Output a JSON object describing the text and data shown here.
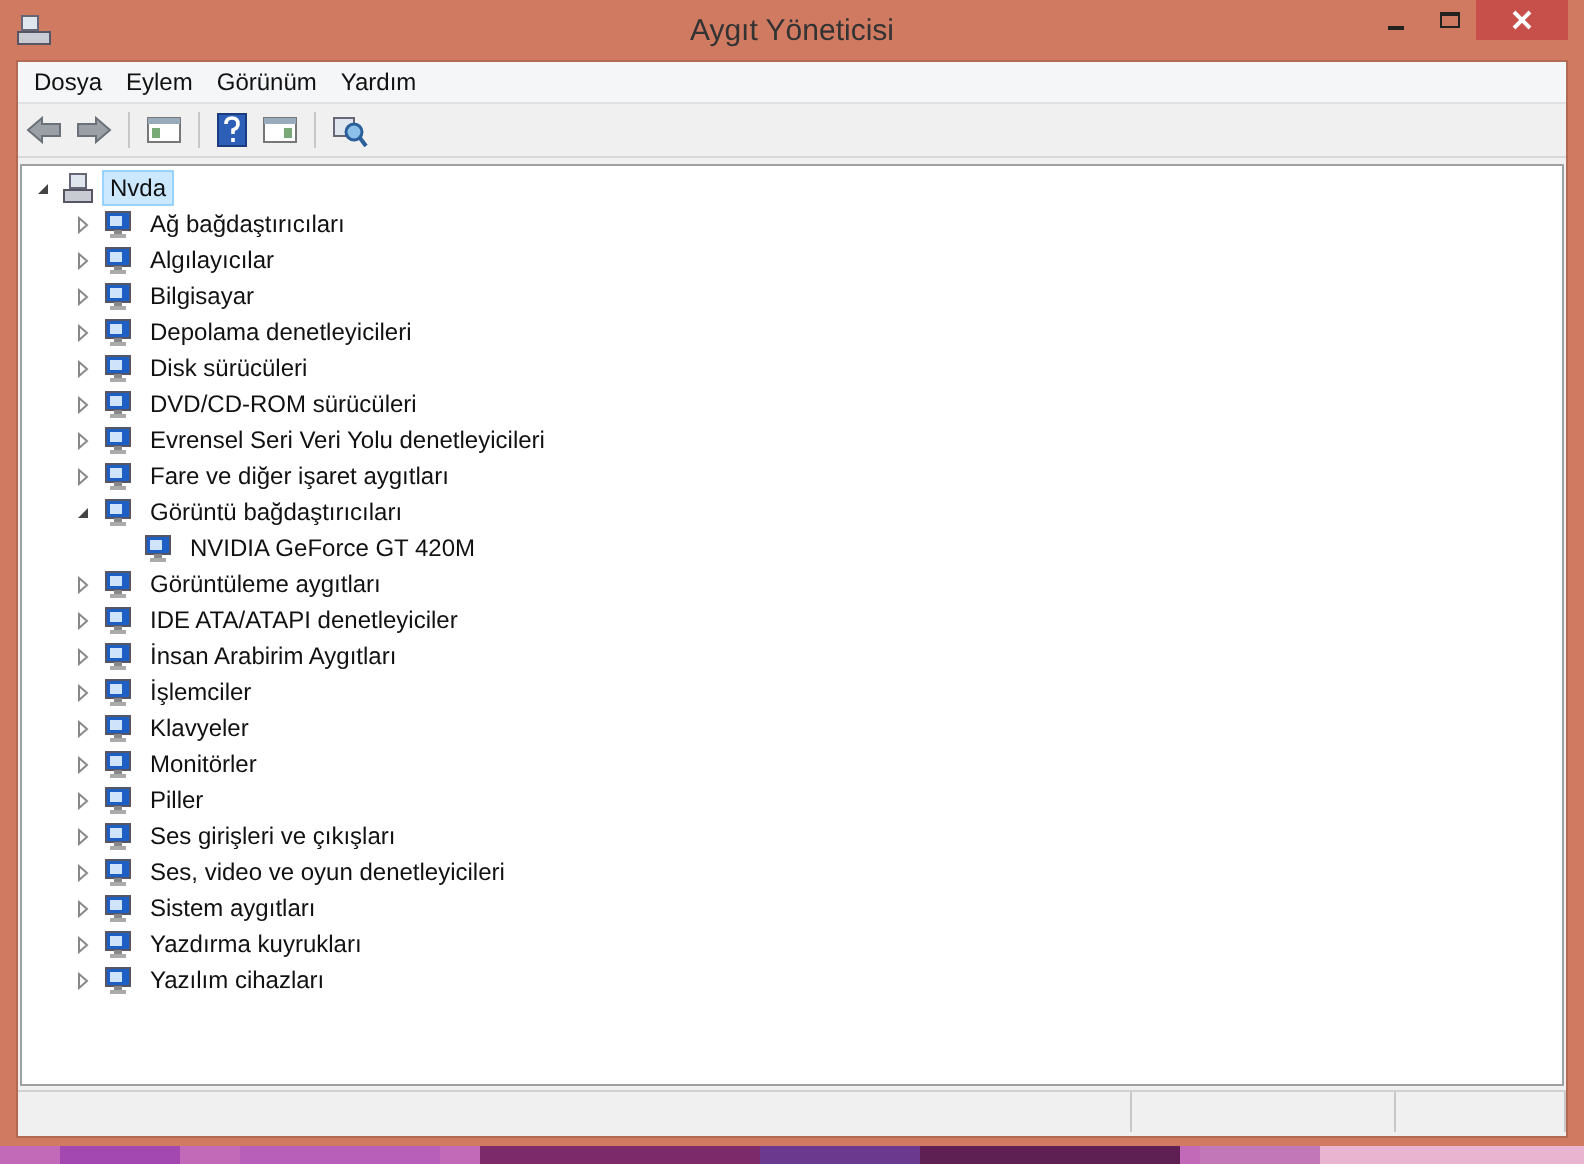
{
  "window": {
    "title": "Aygıt Yöneticisi"
  },
  "menu": [
    "Dosya",
    "Eylem",
    "Görünüm",
    "Yardım"
  ],
  "tree": {
    "label": "Nvda",
    "expanded": true,
    "selected": true,
    "children": [
      {
        "label": "Ağ bağdaştırıcıları",
        "expanded": false
      },
      {
        "label": "Algılayıcılar",
        "expanded": false
      },
      {
        "label": "Bilgisayar",
        "expanded": false
      },
      {
        "label": "Depolama denetleyicileri",
        "expanded": false
      },
      {
        "label": "Disk sürücüleri",
        "expanded": false
      },
      {
        "label": "DVD/CD-ROM sürücüleri",
        "expanded": false
      },
      {
        "label": "Evrensel Seri Veri Yolu denetleyicileri",
        "expanded": false
      },
      {
        "label": "Fare ve diğer işaret aygıtları",
        "expanded": false
      },
      {
        "label": "Görüntü bağdaştırıcıları",
        "expanded": true,
        "children": [
          {
            "label": "NVIDIA GeForce GT 420M"
          }
        ]
      },
      {
        "label": "Görüntüleme aygıtları",
        "expanded": false
      },
      {
        "label": "IDE ATA/ATAPI denetleyiciler",
        "expanded": false
      },
      {
        "label": "İnsan Arabirim Aygıtları",
        "expanded": false
      },
      {
        "label": "İşlemciler",
        "expanded": false
      },
      {
        "label": "Klavyeler",
        "expanded": false
      },
      {
        "label": "Monitörler",
        "expanded": false
      },
      {
        "label": "Piller",
        "expanded": false
      },
      {
        "label": "Ses girişleri ve çıkışları",
        "expanded": false
      },
      {
        "label": "Ses, video ve oyun denetleyicileri",
        "expanded": false
      },
      {
        "label": "Sistem aygıtları",
        "expanded": false
      },
      {
        "label": "Yazdırma kuyrukları",
        "expanded": false
      },
      {
        "label": "Yazılım cihazları",
        "expanded": false
      }
    ]
  }
}
